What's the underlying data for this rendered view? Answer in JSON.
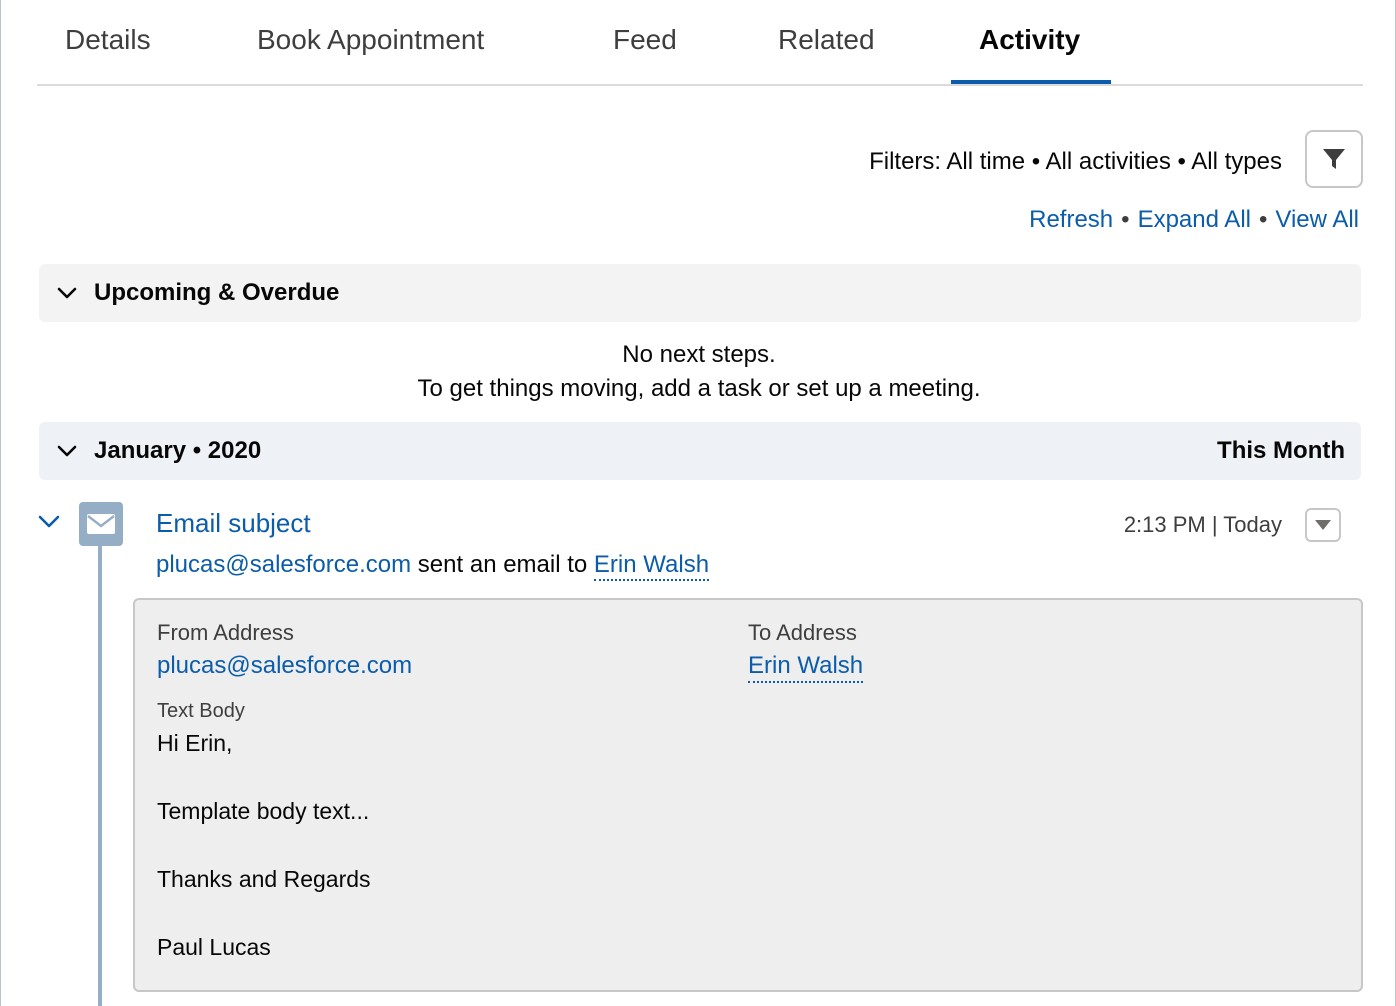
{
  "tabs": [
    {
      "label": "Details"
    },
    {
      "label": "Book Appointment"
    },
    {
      "label": "Feed"
    },
    {
      "label": "Related"
    },
    {
      "label": "Activity",
      "active": true
    }
  ],
  "filters": {
    "text": "Filters: All time • All activities • All types",
    "icon": "filter-icon"
  },
  "actions": {
    "refresh": "Refresh",
    "expand_all": "Expand All",
    "view_all": "View All",
    "separator": "•"
  },
  "upcoming": {
    "title": "Upcoming & Overdue",
    "empty_line1": "No next steps.",
    "empty_line2": "To get things moving, add a task or set up a meeting."
  },
  "month_section": {
    "title": "January • 2020",
    "right_label": "This Month"
  },
  "email_item": {
    "subject": "Email subject",
    "time": "2:13 PM | Today",
    "sender": "plucas@salesforce.com",
    "sent_text": " sent an email to ",
    "recipient": "Erin Walsh",
    "from_label": "From Address",
    "from_value": "plucas@salesforce.com",
    "to_label": "To Address",
    "to_value": "Erin Walsh",
    "body_label": "Text Body",
    "body_lines": [
      "Hi Erin,",
      "Template body text...",
      "Thanks and Regards",
      "Paul Lucas"
    ]
  },
  "colors": {
    "link": "#0b5cab",
    "active_tab_underline": "#0b5cab",
    "email_icon_bg": "#95aec5"
  }
}
